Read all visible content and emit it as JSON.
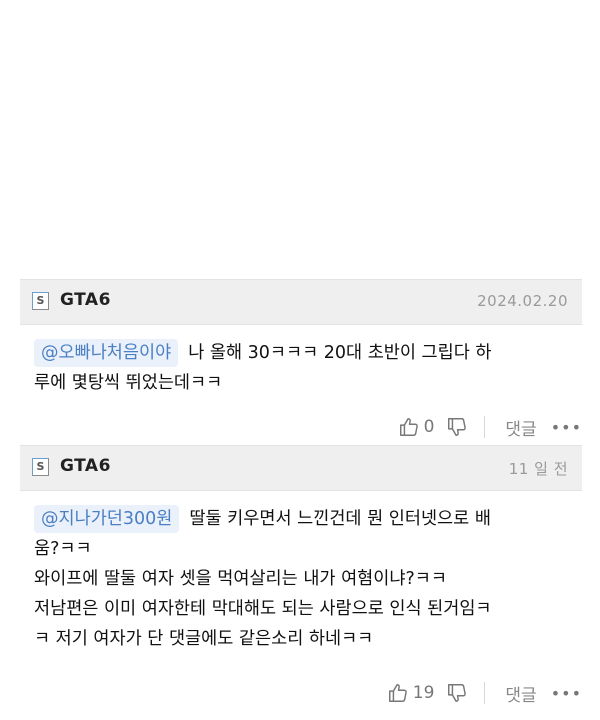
{
  "comments": [
    {
      "username": "GTA6",
      "date": "2024.02.20",
      "mention": "@오빠나처음이야",
      "lines": [
        "나 올해 30ㅋㅋㅋ 20대 초반이 그립다 하",
        "루에 몇탕씩 뛰었는데ㅋㅋ"
      ],
      "likes": "0",
      "reply_label": "댓글",
      "more_label": "•••"
    },
    {
      "username": "GTA6",
      "date": "11 일 전",
      "mention": "@지나가던300원",
      "lines": [
        "딸둘 키우면서 느낀건데 뭔 인터넷으로 배",
        "움?ㅋㅋ",
        "와이프에 딸둘 여자 셋을 먹여살리는 내가 여혐이냐?ㅋㅋ",
        "저남편은 이미 여자한테 막대해도 되는 사람으로 인식 된거임ㅋ",
        "ㅋ 저기 여자가 단 댓글에도 같은소리 하네ㅋㅋ"
      ],
      "likes": "19",
      "reply_label": "댓글",
      "more_label": "•••"
    }
  ],
  "icons": {
    "site_badge": "S",
    "like": "thumbs-up-icon",
    "dislike": "thumbs-down-icon"
  },
  "colors": {
    "header_bg": "#efefef",
    "mention_bg": "#eaf1fb",
    "mention_text": "#4a7fc4",
    "date_text": "#9a9a9a"
  }
}
